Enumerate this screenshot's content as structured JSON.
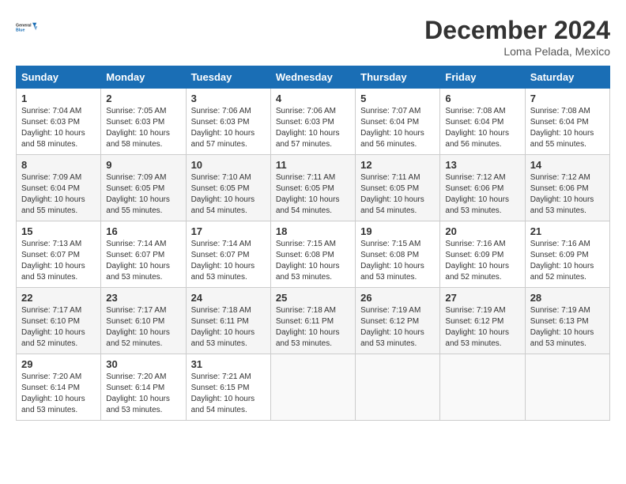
{
  "header": {
    "logo_general": "General",
    "logo_blue": "Blue",
    "main_title": "December 2024",
    "subtitle": "Loma Pelada, Mexico"
  },
  "calendar": {
    "days_of_week": [
      "Sunday",
      "Monday",
      "Tuesday",
      "Wednesday",
      "Thursday",
      "Friday",
      "Saturday"
    ],
    "weeks": [
      [
        {
          "day": "1",
          "info": "Sunrise: 7:04 AM\nSunset: 6:03 PM\nDaylight: 10 hours\nand 58 minutes."
        },
        {
          "day": "2",
          "info": "Sunrise: 7:05 AM\nSunset: 6:03 PM\nDaylight: 10 hours\nand 58 minutes."
        },
        {
          "day": "3",
          "info": "Sunrise: 7:06 AM\nSunset: 6:03 PM\nDaylight: 10 hours\nand 57 minutes."
        },
        {
          "day": "4",
          "info": "Sunrise: 7:06 AM\nSunset: 6:03 PM\nDaylight: 10 hours\nand 57 minutes."
        },
        {
          "day": "5",
          "info": "Sunrise: 7:07 AM\nSunset: 6:04 PM\nDaylight: 10 hours\nand 56 minutes."
        },
        {
          "day": "6",
          "info": "Sunrise: 7:08 AM\nSunset: 6:04 PM\nDaylight: 10 hours\nand 56 minutes."
        },
        {
          "day": "7",
          "info": "Sunrise: 7:08 AM\nSunset: 6:04 PM\nDaylight: 10 hours\nand 55 minutes."
        }
      ],
      [
        {
          "day": "8",
          "info": "Sunrise: 7:09 AM\nSunset: 6:04 PM\nDaylight: 10 hours\nand 55 minutes."
        },
        {
          "day": "9",
          "info": "Sunrise: 7:09 AM\nSunset: 6:05 PM\nDaylight: 10 hours\nand 55 minutes."
        },
        {
          "day": "10",
          "info": "Sunrise: 7:10 AM\nSunset: 6:05 PM\nDaylight: 10 hours\nand 54 minutes."
        },
        {
          "day": "11",
          "info": "Sunrise: 7:11 AM\nSunset: 6:05 PM\nDaylight: 10 hours\nand 54 minutes."
        },
        {
          "day": "12",
          "info": "Sunrise: 7:11 AM\nSunset: 6:05 PM\nDaylight: 10 hours\nand 54 minutes."
        },
        {
          "day": "13",
          "info": "Sunrise: 7:12 AM\nSunset: 6:06 PM\nDaylight: 10 hours\nand 53 minutes."
        },
        {
          "day": "14",
          "info": "Sunrise: 7:12 AM\nSunset: 6:06 PM\nDaylight: 10 hours\nand 53 minutes."
        }
      ],
      [
        {
          "day": "15",
          "info": "Sunrise: 7:13 AM\nSunset: 6:07 PM\nDaylight: 10 hours\nand 53 minutes."
        },
        {
          "day": "16",
          "info": "Sunrise: 7:14 AM\nSunset: 6:07 PM\nDaylight: 10 hours\nand 53 minutes."
        },
        {
          "day": "17",
          "info": "Sunrise: 7:14 AM\nSunset: 6:07 PM\nDaylight: 10 hours\nand 53 minutes."
        },
        {
          "day": "18",
          "info": "Sunrise: 7:15 AM\nSunset: 6:08 PM\nDaylight: 10 hours\nand 53 minutes."
        },
        {
          "day": "19",
          "info": "Sunrise: 7:15 AM\nSunset: 6:08 PM\nDaylight: 10 hours\nand 53 minutes."
        },
        {
          "day": "20",
          "info": "Sunrise: 7:16 AM\nSunset: 6:09 PM\nDaylight: 10 hours\nand 52 minutes."
        },
        {
          "day": "21",
          "info": "Sunrise: 7:16 AM\nSunset: 6:09 PM\nDaylight: 10 hours\nand 52 minutes."
        }
      ],
      [
        {
          "day": "22",
          "info": "Sunrise: 7:17 AM\nSunset: 6:10 PM\nDaylight: 10 hours\nand 52 minutes."
        },
        {
          "day": "23",
          "info": "Sunrise: 7:17 AM\nSunset: 6:10 PM\nDaylight: 10 hours\nand 52 minutes."
        },
        {
          "day": "24",
          "info": "Sunrise: 7:18 AM\nSunset: 6:11 PM\nDaylight: 10 hours\nand 53 minutes."
        },
        {
          "day": "25",
          "info": "Sunrise: 7:18 AM\nSunset: 6:11 PM\nDaylight: 10 hours\nand 53 minutes."
        },
        {
          "day": "26",
          "info": "Sunrise: 7:19 AM\nSunset: 6:12 PM\nDaylight: 10 hours\nand 53 minutes."
        },
        {
          "day": "27",
          "info": "Sunrise: 7:19 AM\nSunset: 6:12 PM\nDaylight: 10 hours\nand 53 minutes."
        },
        {
          "day": "28",
          "info": "Sunrise: 7:19 AM\nSunset: 6:13 PM\nDaylight: 10 hours\nand 53 minutes."
        }
      ],
      [
        {
          "day": "29",
          "info": "Sunrise: 7:20 AM\nSunset: 6:14 PM\nDaylight: 10 hours\nand 53 minutes."
        },
        {
          "day": "30",
          "info": "Sunrise: 7:20 AM\nSunset: 6:14 PM\nDaylight: 10 hours\nand 53 minutes."
        },
        {
          "day": "31",
          "info": "Sunrise: 7:21 AM\nSunset: 6:15 PM\nDaylight: 10 hours\nand 54 minutes."
        },
        {
          "day": "",
          "info": ""
        },
        {
          "day": "",
          "info": ""
        },
        {
          "day": "",
          "info": ""
        },
        {
          "day": "",
          "info": ""
        }
      ]
    ]
  }
}
